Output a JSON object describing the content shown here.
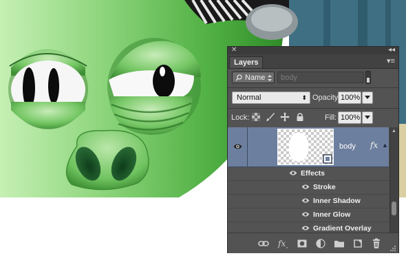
{
  "panel": {
    "close_glyph": "✕",
    "collapse_glyph": "◂◂",
    "tab_label": "Layers",
    "menu_glyph": "▾≡"
  },
  "filter": {
    "kind_label": "Name",
    "search_placeholder": "body"
  },
  "blend": {
    "mode": "Normal",
    "opacity_label": "Opacity:",
    "opacity_value": "100%"
  },
  "lock": {
    "label": "Lock:",
    "fill_label": "Fill:",
    "fill_value": "100%"
  },
  "layer": {
    "name": "body",
    "fx_badge": "fx",
    "effects_label": "Effects",
    "effects": [
      "Stroke",
      "Inner Shadow",
      "Inner Glow",
      "Gradient Overlay"
    ]
  },
  "icons": {
    "eye": "eye-icon",
    "link": "link-layers-icon",
    "fx": "add-layer-style-icon",
    "mask": "add-mask-icon",
    "adjust": "new-adjustment-layer-icon",
    "folder": "new-group-icon",
    "newlayer": "new-layer-icon",
    "trash": "delete-layer-icon"
  },
  "colors": {
    "panel_bg": "#535353",
    "selection": "#6d7f9e",
    "artwork_green": "#56b84e"
  }
}
